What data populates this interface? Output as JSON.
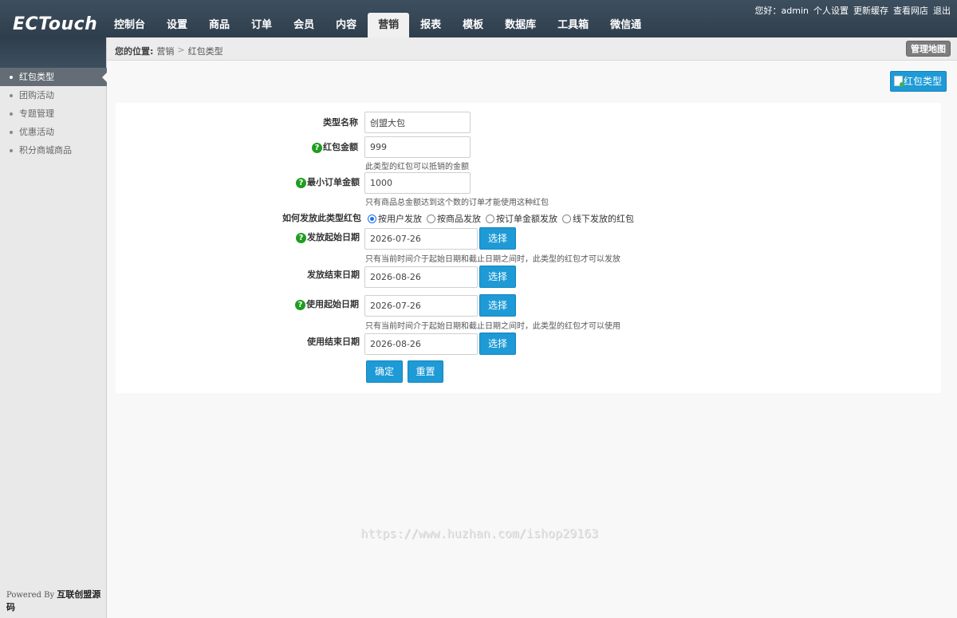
{
  "logo": "ECTouch",
  "nav": [
    "控制台",
    "设置",
    "商品",
    "订单",
    "会员",
    "内容",
    "营销",
    "报表",
    "模板",
    "数据库",
    "工具箱",
    "微信通"
  ],
  "nav_active": "营销",
  "user_links": {
    "greeting": "您好：admin",
    "profile": "个人设置",
    "clear_cache": "更新缓存",
    "view_site": "查看网店",
    "logout": "退出"
  },
  "breadcrumb": {
    "label": "您的位置:",
    "section": "营销",
    "separator": ">",
    "page": "红包类型"
  },
  "sitemap_button": "管理地图",
  "sidebar": {
    "items": [
      "红包类型",
      "团购活动",
      "专题管理",
      "优惠活动",
      "积分商城商品"
    ],
    "active": "红包类型",
    "powered_prefix": "Powered By",
    "powered_brand": "互联创盟源码"
  },
  "action_button": "红包类型",
  "form": {
    "name_label": "类型名称",
    "name_value": "创盟大包",
    "amount_label": "红包金额",
    "amount_value": "999",
    "amount_tip": "此类型的红包可以抵销的金额",
    "min_label": "最小订单金额",
    "min_value": "1000",
    "min_tip": "只有商品总金额达到这个数的订单才能使用这种红包",
    "send_type_label": "如何发放此类型红包",
    "send_types": [
      "按用户发放",
      "按商品发放",
      "按订单金额发放",
      "线下发放的红包"
    ],
    "send_type_selected": "按用户发放",
    "send_start_label": "发放起始日期",
    "send_start_value": "2026-07-26",
    "send_tip": "只有当前时间介于起始日期和截止日期之间时，此类型的红包才可以发放",
    "send_end_label": "发放结束日期",
    "send_end_value": "2026-08-26",
    "use_start_label": "使用起始日期",
    "use_start_value": "2026-07-26",
    "use_tip": "只有当前时间介于起始日期和截止日期之间时，此类型的红包才可以使用",
    "use_end_label": "使用结束日期",
    "use_end_value": "2026-08-26",
    "pick_label": "选择",
    "submit_label": "确定",
    "reset_label": "重置",
    "help_glyph": "?"
  },
  "watermark": "https://www.huzhan.com/ishop29163",
  "colors": {
    "header": "#34495e",
    "accent": "#1e9ad6",
    "help": "#1f9d1f",
    "sidebar_active": "#646d75"
  }
}
